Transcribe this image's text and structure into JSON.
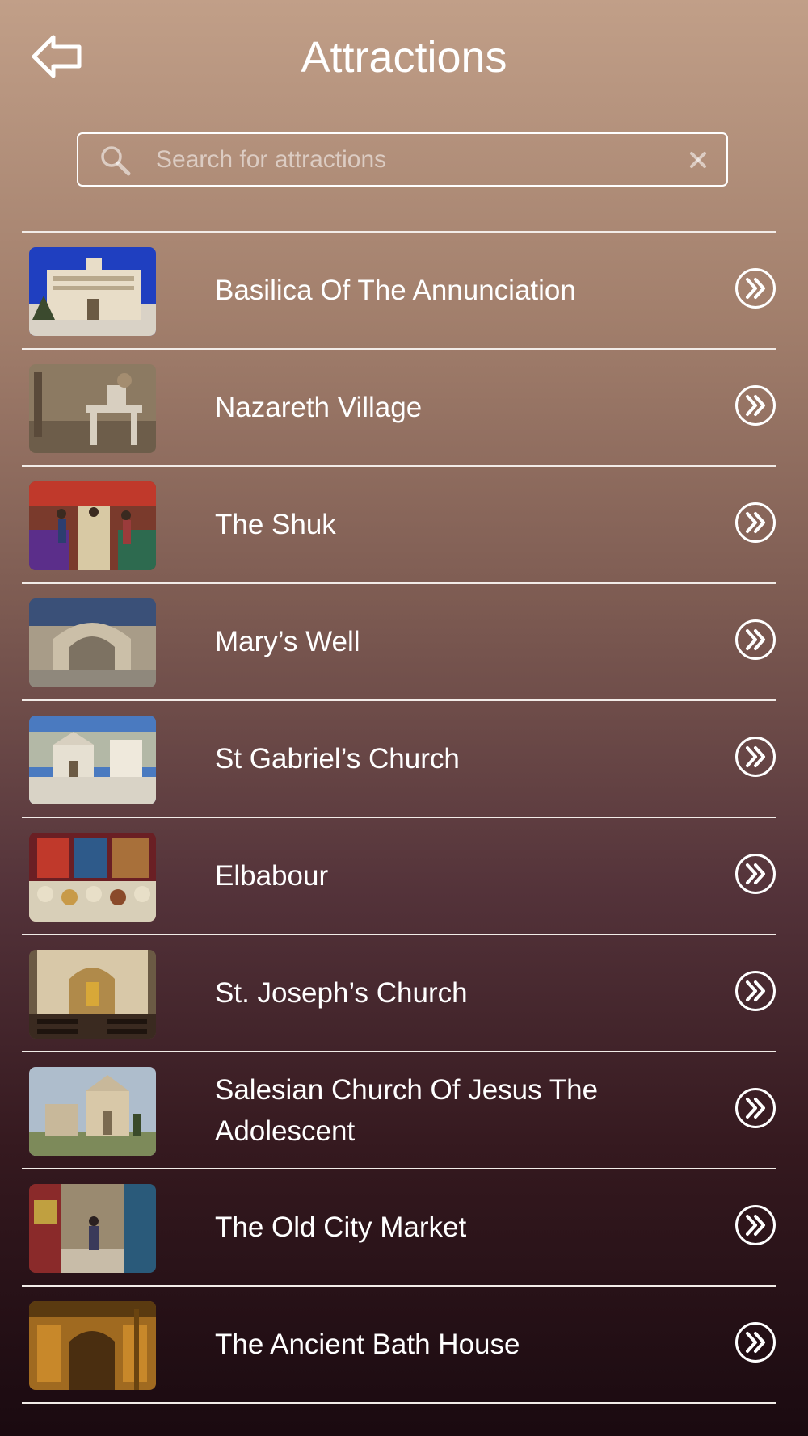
{
  "header": {
    "title": "Attractions",
    "back_icon": "back-arrow-icon"
  },
  "search": {
    "placeholder": "Search for attractions",
    "value": "",
    "search_icon": "magnifier-icon",
    "clear_icon": "close-icon"
  },
  "colors": {
    "gradient_top": "#c19f88",
    "gradient_bottom": "#1a0a10",
    "text": "#ffffff",
    "divider": "#f2ece8"
  },
  "attractions": [
    {
      "name": "Basilica Of The Annunciation",
      "thumbnail": "basilica-photo",
      "action_icon": "double-chevron-right-icon"
    },
    {
      "name": "Nazareth Village",
      "thumbnail": "village-workshop-photo",
      "action_icon": "double-chevron-right-icon"
    },
    {
      "name": "The Shuk",
      "thumbnail": "market-crowd-photo",
      "action_icon": "double-chevron-right-icon"
    },
    {
      "name": "Mary’s Well",
      "thumbnail": "stone-well-photo",
      "action_icon": "double-chevron-right-icon"
    },
    {
      "name": "St Gabriel’s Church",
      "thumbnail": "church-square-photo",
      "action_icon": "double-chevron-right-icon"
    },
    {
      "name": "Elbabour",
      "thumbnail": "spice-shop-photo",
      "action_icon": "double-chevron-right-icon"
    },
    {
      "name": "St. Joseph’s Church",
      "thumbnail": "church-interior-photo",
      "action_icon": "double-chevron-right-icon"
    },
    {
      "name": "Salesian Church Of Jesus The Adolescent",
      "thumbnail": "hilltop-church-photo",
      "action_icon": "double-chevron-right-icon"
    },
    {
      "name": "The Old City Market",
      "thumbnail": "alley-market-photo",
      "action_icon": "double-chevron-right-icon"
    },
    {
      "name": "The Ancient Bath House",
      "thumbnail": "bath-house-photo",
      "action_icon": "double-chevron-right-icon"
    }
  ]
}
